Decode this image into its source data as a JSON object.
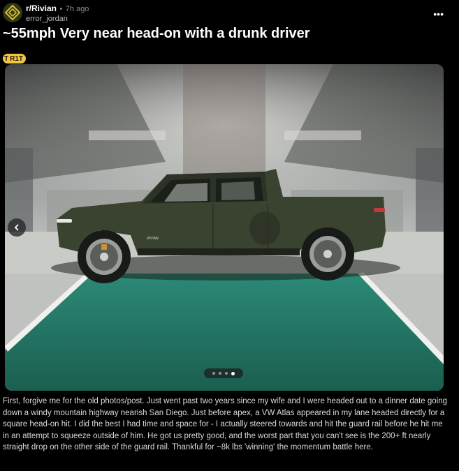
{
  "post": {
    "subreddit": "r/Rivian",
    "separator": "•",
    "time": "7h ago",
    "author": "error_jordan",
    "more_label": "•••",
    "title": "~55mph Very near head-on with a drunk driver",
    "flair": {
      "icon_letter": "T",
      "text": "R1T"
    },
    "body": "First, forgive me for the old photos/post. Just went past two years since my wife and I were headed out to a dinner date going down a windy mountain highway nearish San Diego. Just before apex, a VW Atlas appeared in my lane headed directly for a square head-on hit. I did the best I had time and space for - I actually steered towards and hit the guard rail before he hit me in an attempt to squeeze outside of him. He got us pretty good, and the worst part that you can't see is the 200+ ft nearly straight drop on the other side of the guard rail. Thankful for ~8k lbs 'winning' the momentum battle here."
  },
  "carousel": {
    "truck_badge": "RIVIAN",
    "slide_count": 4,
    "active_slide": 4
  },
  "colors": {
    "background": "#000000",
    "flair": "#f4c53d",
    "truck": "#3a4230",
    "floor": "#1f6e5e"
  },
  "icons": {
    "avatar": "rivian-diamond-icon",
    "more": "more-options-icon",
    "prev": "chevron-left-icon"
  }
}
